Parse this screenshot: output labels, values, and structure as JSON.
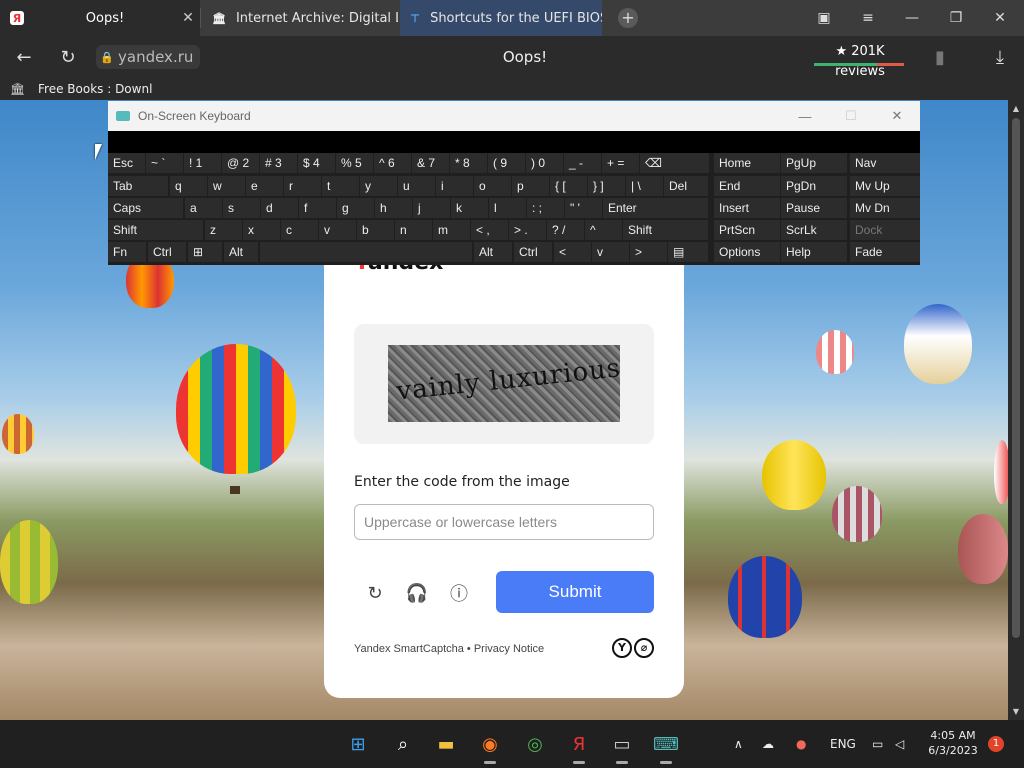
{
  "browser": {
    "tabs": [
      {
        "title": "Oops!",
        "favicon": "yandex-favicon",
        "close": "✕"
      },
      {
        "title": "Internet Archive: Digital Lib",
        "favicon": "archive-favicon"
      },
      {
        "title": "Shortcuts for the UEFI BIOS",
        "favicon": "pin-favicon"
      }
    ],
    "new_tab": "+",
    "url": "yandex.ru",
    "page_title": "Oops!",
    "reviews": "★ 201K reviews",
    "bookmark": "Free Books : Downl",
    "window": {
      "minimize": "—",
      "restore": "❐",
      "close": "✕"
    }
  },
  "captcha": {
    "brand_prefix": "Y",
    "brand_rest": "andex",
    "image_text": "vainly luxurious",
    "label": "Enter the code from the image",
    "placeholder": "Uppercase or lowercase letters",
    "submit": "Submit",
    "footer_product": "Yandex SmartCaptcha",
    "footer_sep": " • ",
    "footer_link": "Privacy Notice",
    "logo_left": "Y",
    "logo_right": "⌀"
  },
  "osk": {
    "title": "On-Screen Keyboard",
    "minimize": "—",
    "maximize": "☐",
    "close": "✕",
    "rows": [
      [
        "Esc",
        "~ `",
        "! 1",
        "@ 2",
        "# 3",
        "$ 4",
        "% 5",
        "^ 6",
        "& 7",
        "* 8",
        "( 9",
        ") 0",
        "_ -",
        "+ =",
        "⌫",
        "Home",
        "PgUp",
        "Nav"
      ],
      [
        "Tab",
        "q",
        "w",
        "e",
        "r",
        "t",
        "y",
        "u",
        "i",
        "o",
        "p",
        "{ [",
        "} ]",
        "| \\",
        "Del",
        "End",
        "PgDn",
        "Mv Up"
      ],
      [
        "Caps",
        "a",
        "s",
        "d",
        "f",
        "g",
        "h",
        "j",
        "k",
        "l",
        ": ;",
        "\" '",
        "Enter",
        "Insert",
        "Pause",
        "Mv Dn"
      ],
      [
        "Shift",
        "z",
        "x",
        "c",
        "v",
        "b",
        "n",
        "m",
        "< ,",
        "> .",
        "? /",
        "^",
        "Shift",
        "PrtScn",
        "ScrLk",
        "Dock"
      ],
      [
        "Fn",
        "Ctrl",
        "⊞",
        "Alt",
        "",
        "Alt",
        "Ctrl",
        "<",
        "v",
        ">",
        "▤",
        "Options",
        "Help",
        "Fade"
      ]
    ]
  },
  "taskbar": {
    "language": "ENG",
    "time": "4:05 AM",
    "date": "6/3/2023",
    "notifications": "1"
  }
}
